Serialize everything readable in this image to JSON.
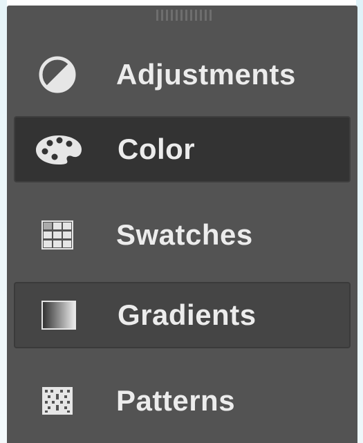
{
  "panel": {
    "items": [
      {
        "label": "Adjustments",
        "icon": "adjustments-icon",
        "selected": false
      },
      {
        "label": "Color",
        "icon": "palette-icon",
        "selected": true
      },
      {
        "label": "Swatches",
        "icon": "swatches-grid-icon",
        "selected": false
      },
      {
        "label": "Gradients",
        "icon": "gradient-icon",
        "selected": false
      },
      {
        "label": "Patterns",
        "icon": "patterns-icon",
        "selected": false
      }
    ]
  },
  "colors": {
    "panel_bg": "#535353",
    "selected_bg": "#333333",
    "text": "#ececec",
    "icon": "#e6e6e6"
  }
}
